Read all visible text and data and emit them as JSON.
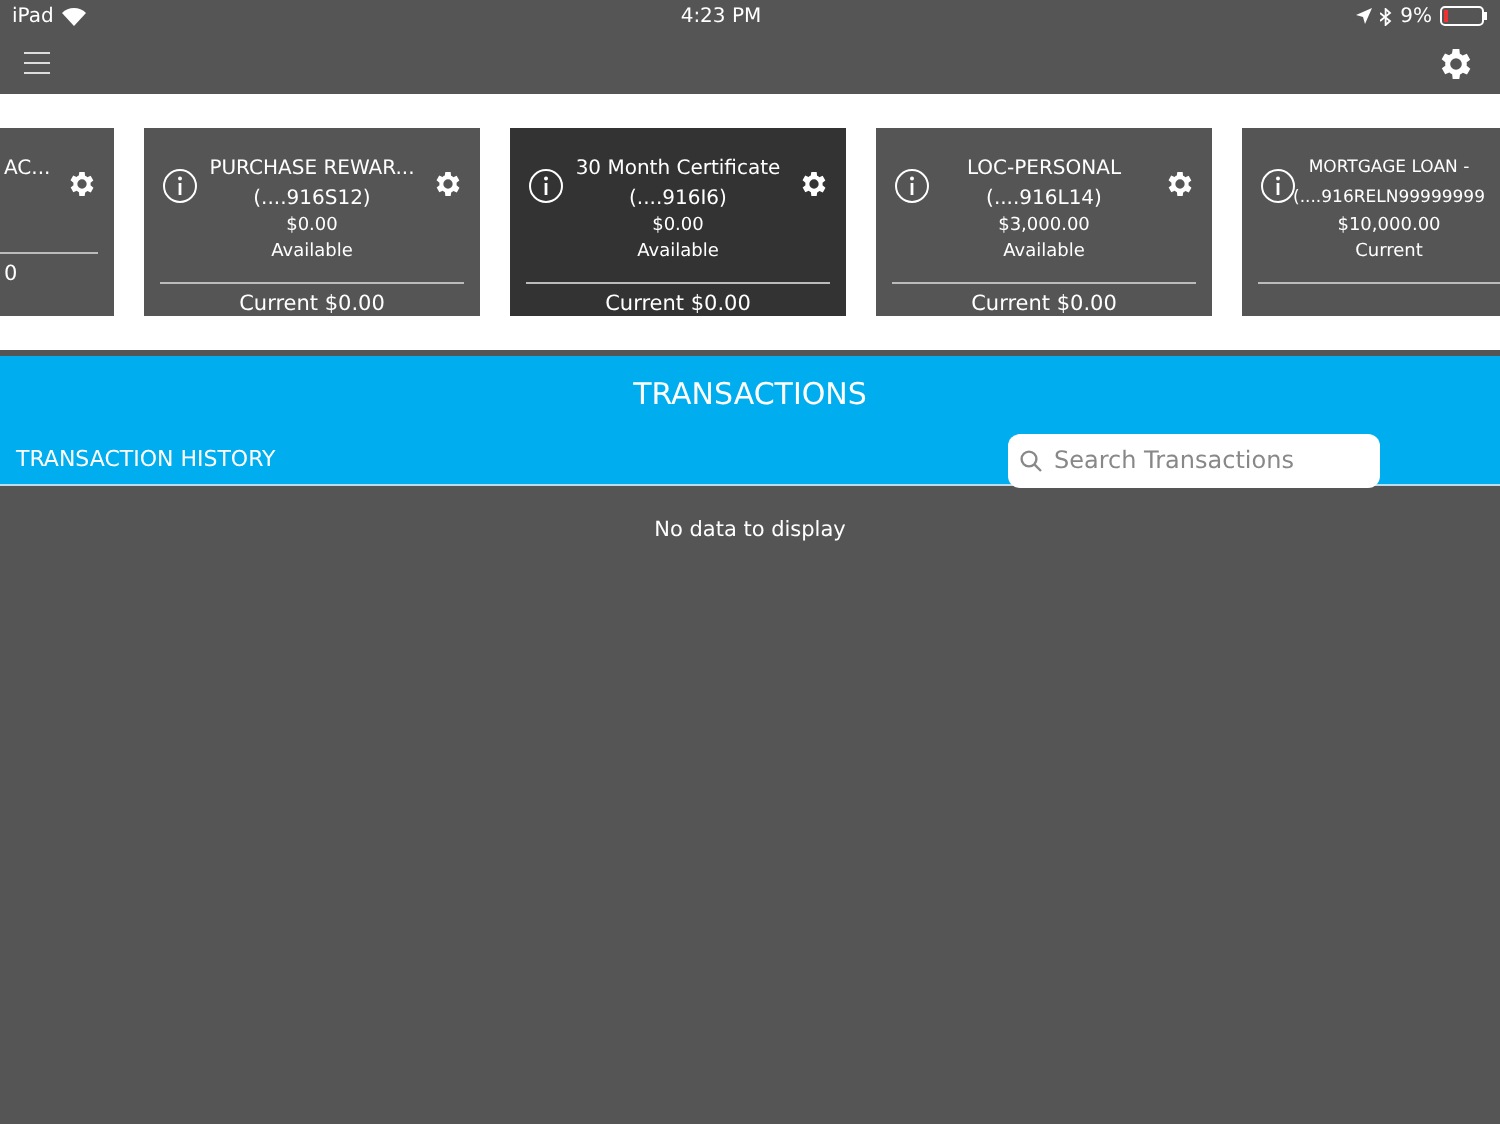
{
  "status_bar": {
    "device": "iPad",
    "time": "4:23 PM",
    "battery": "9%"
  },
  "accounts": [
    {
      "kind": "partial-left",
      "title": "AC...",
      "current": "0",
      "selected": false,
      "has_settings": true
    },
    {
      "kind": "full",
      "title": "PURCHASE REWAR...",
      "number": "(....916S12)",
      "amount": "$0.00",
      "amount_label": "Available",
      "current": "Current $0.00",
      "selected": false,
      "has_settings": true
    },
    {
      "kind": "full",
      "title": "30 Month Certificate",
      "number": "(....916I6)",
      "amount": "$0.00",
      "amount_label": "Available",
      "current": "Current $0.00",
      "selected": true,
      "has_settings": true
    },
    {
      "kind": "full",
      "title": "LOC-PERSONAL",
      "number": "(....916L14)",
      "amount": "$3,000.00",
      "amount_label": "Available",
      "current": "Current $0.00",
      "selected": false,
      "has_settings": true
    },
    {
      "kind": "partial-right",
      "title": "MORTGAGE LOAN -",
      "number": "(....916RELN99999999",
      "amount": "$10,000.00",
      "amount_label": "Current",
      "selected": false,
      "has_settings": false
    }
  ],
  "transactions": {
    "title": "TRANSACTIONS",
    "subtitle": "TRANSACTION HISTORY",
    "search": {
      "placeholder": "Search Transactions"
    },
    "empty_message": "No data to display"
  }
}
